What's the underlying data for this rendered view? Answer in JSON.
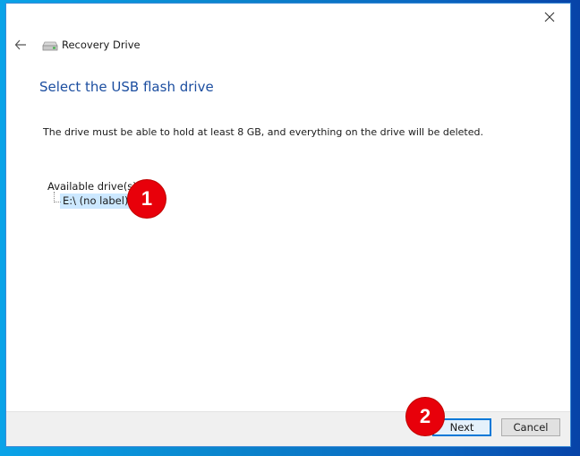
{
  "window": {
    "app_title": "Recovery Drive",
    "page_title": "Select the USB flash drive",
    "instructions": "The drive must be able to hold at least 8 GB, and everything on the drive will be deleted.",
    "icons": {
      "close": "close-icon",
      "back": "back-arrow-icon",
      "app": "drive-icon"
    }
  },
  "drives": {
    "header": "Available drive(s)",
    "items": [
      {
        "label": "E:\\ (no label)",
        "selected": true
      }
    ]
  },
  "footer": {
    "next_label": "Next",
    "cancel_label": "Cancel"
  },
  "annotations": {
    "step1": "1",
    "step2": "2"
  },
  "colors": {
    "title_blue": "#1c4ea0",
    "selection": "#cce8ff",
    "badge_red": "#e8000a",
    "focus_blue": "#0078d7"
  }
}
